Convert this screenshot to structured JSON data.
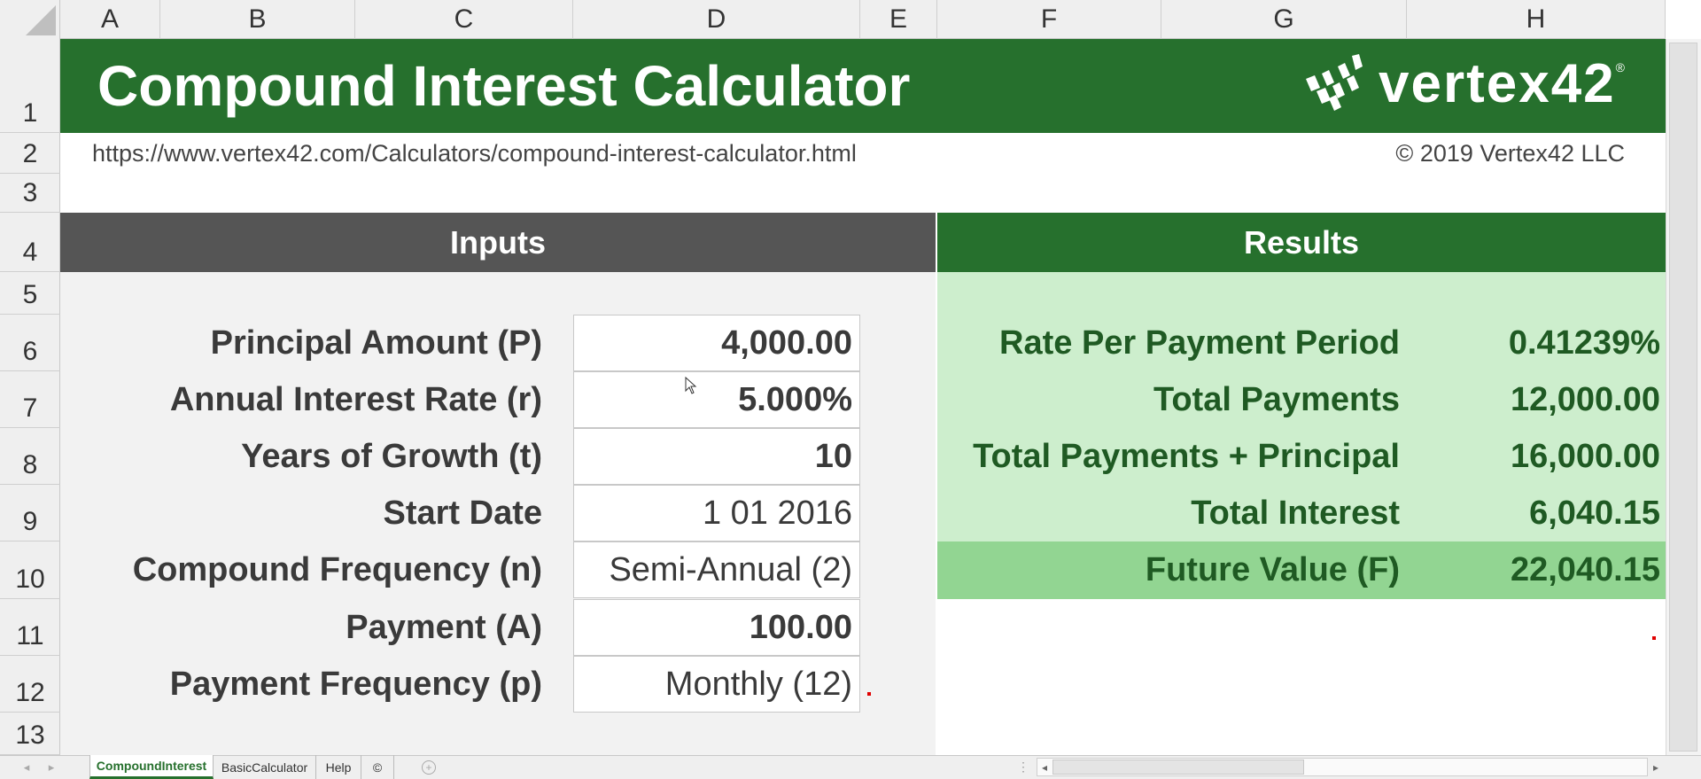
{
  "columns": [
    "A",
    "B",
    "C",
    "D",
    "E",
    "F",
    "G",
    "H"
  ],
  "rows": [
    "1",
    "2",
    "3",
    "4",
    "5",
    "6",
    "7",
    "8",
    "9",
    "10",
    "11",
    "12",
    "13"
  ],
  "header": {
    "title": "Compound Interest Calculator",
    "logo_text": "vertex42",
    "logo_mark": "®",
    "url": "https://www.vertex42.com/Calculators/compound-interest-calculator.html",
    "copyright": "© 2019 Vertex42 LLC",
    "brand_color": "#26702d"
  },
  "inputs": {
    "title": "Inputs",
    "fields": [
      {
        "label": "Principal Amount (P)",
        "value": "4,000.00"
      },
      {
        "label": "Annual Interest Rate (r)",
        "value": "5.000%"
      },
      {
        "label": "Years of Growth (t)",
        "value": "10"
      },
      {
        "label": "Start Date",
        "value": "1 01 2016"
      },
      {
        "label": "Compound Frequency (n)",
        "value": "Semi-Annual (2)"
      },
      {
        "label": "Payment (A)",
        "value": "100.00"
      },
      {
        "label": "Payment Frequency (p)",
        "value": "Monthly (12)"
      }
    ]
  },
  "results": {
    "title": "Results",
    "items": [
      {
        "label": "Rate Per Payment Period",
        "value": "0.41239%"
      },
      {
        "label": "Total Payments",
        "value": "12,000.00"
      },
      {
        "label": "Total Payments + Principal",
        "value": "16,000.00"
      },
      {
        "label": "Total Interest",
        "value": "6,040.15"
      },
      {
        "label": "Future Value (F)",
        "value": "22,040.15"
      }
    ]
  },
  "sheet_tabs": [
    {
      "label": "CompoundInterest",
      "active": true
    },
    {
      "label": "BasicCalculator",
      "active": false
    },
    {
      "label": "Help",
      "active": false
    },
    {
      "label": "©",
      "active": false
    }
  ]
}
